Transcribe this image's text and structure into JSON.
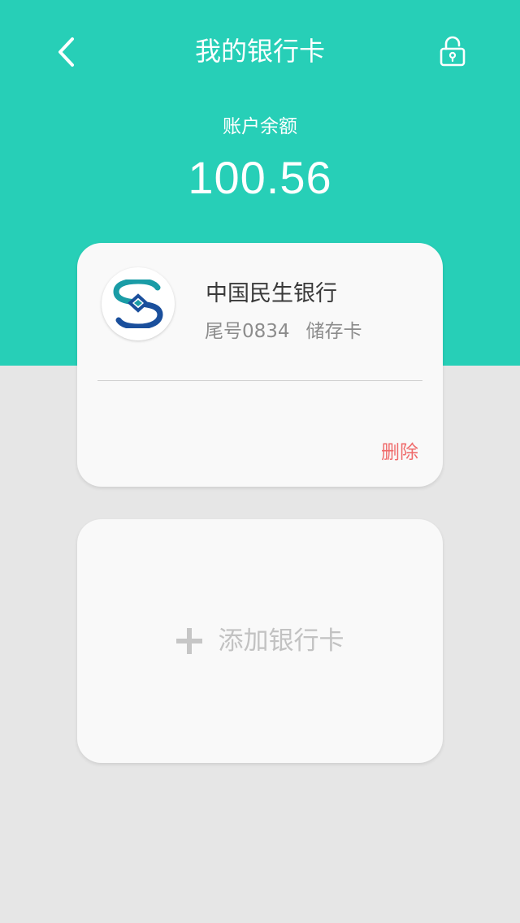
{
  "header": {
    "title": "我的银行卡",
    "background_color": "#27cfb7",
    "back_icon": "chevron-left-icon",
    "lock_icon": "unlock-icon"
  },
  "balance": {
    "label": "账户余额",
    "value": "100.56"
  },
  "bank_card": {
    "bank_name": "中国民生银行",
    "tail_number": "尾号0834",
    "card_type": "储存卡",
    "logo_icon": "cmbc-bank-logo-icon",
    "delete_label": "删除",
    "delete_color": "#ef6b6b"
  },
  "add_card": {
    "label": "添加银行卡",
    "icon": "plus-icon"
  }
}
